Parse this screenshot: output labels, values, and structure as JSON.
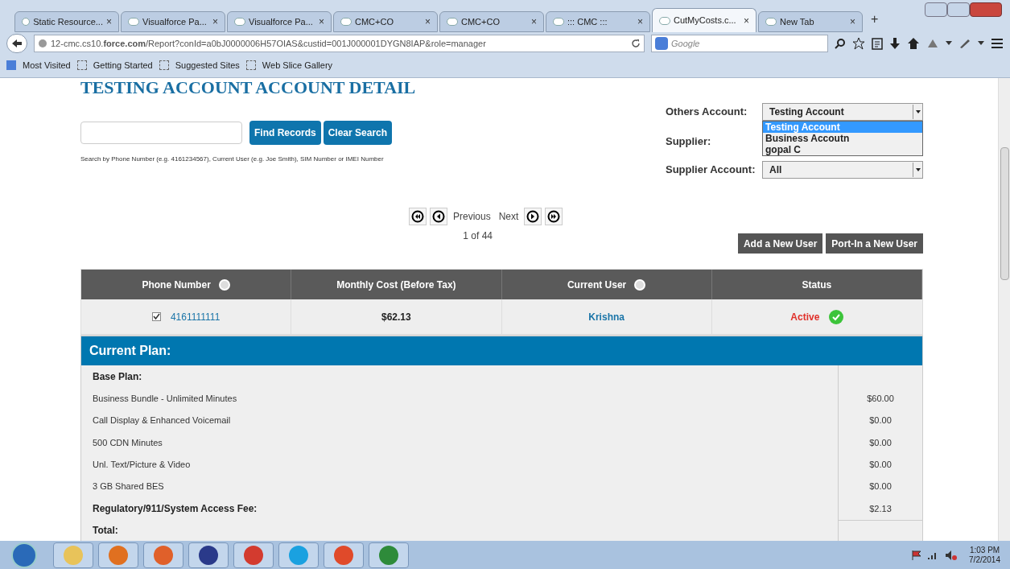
{
  "browser": {
    "tabs": [
      {
        "title": "Static Resource...",
        "close": "×",
        "selected": false
      },
      {
        "title": "Visualforce Pa...",
        "close": "×",
        "selected": false
      },
      {
        "title": "Visualforce Pa...",
        "close": "×",
        "selected": false
      },
      {
        "title": "CMC+CO",
        "close": "×",
        "selected": false
      },
      {
        "title": "CMC+CO",
        "close": "×",
        "selected": false
      },
      {
        "title": "::: CMC :::",
        "close": "×",
        "selected": false
      },
      {
        "title": "CutMyCosts.c...",
        "close": "×",
        "selected": true
      },
      {
        "title": "New Tab",
        "close": "×",
        "selected": false
      }
    ],
    "new_tab": "+",
    "url": "12-cmc.cs10.**force.com**/Report?conId=a0bJ0000006H57OIAS&custid=001J000001DYGN8IAP&role=manager",
    "search_placeholder": "Google",
    "bookmarks": [
      "Most Visited",
      "Getting Started",
      "Suggested Sites",
      "Web Slice Gallery"
    ]
  },
  "page": {
    "title": "TESTING ACCOUNT ACCOUNT DETAIL",
    "search": {
      "buttons": [
        "Find Records",
        "Clear Search"
      ],
      "hint": "Search by Phone Number (e.g. 4161234567), Current User (e.g. Joe Smith), SIM Number or IMEI Number"
    },
    "filters": {
      "others_account": {
        "label": "Others Account:",
        "value": "Testing Account",
        "expanded": true,
        "options": [
          {
            "label": "Testing Account",
            "selected": true
          },
          {
            "label": "Business Accoutn",
            "selected": false
          },
          {
            "label": "gopal C",
            "selected": false
          }
        ]
      },
      "supplier": {
        "label": "Supplier:"
      },
      "supplier_account": {
        "label": "Supplier Account:",
        "value": "All"
      }
    },
    "pagination": {
      "previous": "Previous",
      "next": "Next",
      "page": "1 of 44"
    },
    "actions": [
      "Add a New User",
      "Port-In a New User"
    ],
    "table": {
      "columns": [
        {
          "label": "Phone Number",
          "sortable": true
        },
        {
          "label": "Monthly Cost (Before Tax)",
          "sortable": false
        },
        {
          "label": "Current User",
          "sortable": true
        },
        {
          "label": "Status",
          "sortable": false
        }
      ],
      "rows": [
        {
          "checked": true,
          "phone": "4161111111",
          "cost": "$62.13",
          "user": "Krishna",
          "status": "Active",
          "active": true
        }
      ]
    },
    "plan": {
      "title": "Current Plan:",
      "items": [
        {
          "kind": "heading",
          "label": "Base Plan:"
        },
        {
          "kind": "item",
          "label": "Business Bundle - Unlimited Minutes",
          "amount": "$60.00"
        },
        {
          "kind": "item",
          "label": "Call Display & Enhanced Voicemail",
          "amount": "$0.00"
        },
        {
          "kind": "item",
          "label": "500 CDN Minutes",
          "amount": "$0.00"
        },
        {
          "kind": "item",
          "label": "Unl. Text/Picture & Video",
          "amount": "$0.00"
        },
        {
          "kind": "item",
          "label": "3 GB Shared BES",
          "amount": "$0.00"
        },
        {
          "kind": "heading",
          "label": "Regulatory/911/System Access Fee:",
          "amount": "$2.13"
        },
        {
          "kind": "total",
          "label": "Total:"
        }
      ]
    }
  },
  "taskbar": {
    "time": "1:03 PM",
    "date": "7/2/2014"
  }
}
